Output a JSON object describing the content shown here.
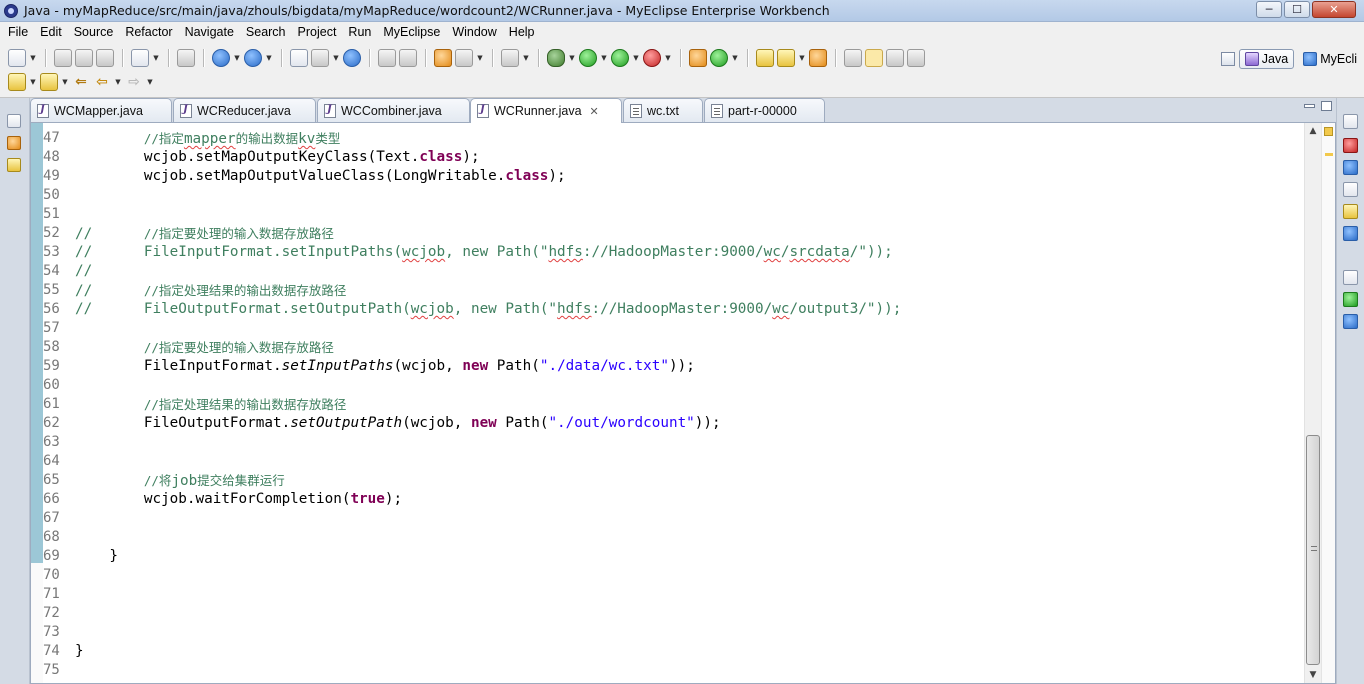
{
  "window": {
    "title": "Java - myMapReduce/src/main/java/zhouls/bigdata/myMapReduce/wordcount2/WCRunner.java - MyEclipse Enterprise Workbench",
    "buttons": {
      "minimize": "─",
      "maximize": "☐",
      "close": "✕"
    }
  },
  "menu": [
    "File",
    "Edit",
    "Source",
    "Refactor",
    "Navigate",
    "Search",
    "Project",
    "Run",
    "MyEclipse",
    "Window",
    "Help"
  ],
  "perspectives": [
    {
      "label": "Java",
      "active": true
    },
    {
      "label": "MyEcli",
      "active": false
    }
  ],
  "tabs": [
    {
      "label": "WCMapper.java",
      "kind": "java",
      "active": false
    },
    {
      "label": "WCReducer.java",
      "kind": "java",
      "active": false
    },
    {
      "label": "WCCombiner.java",
      "kind": "java",
      "active": false
    },
    {
      "label": "WCRunner.java",
      "kind": "java",
      "active": true,
      "close": "✕"
    },
    {
      "label": "wc.txt",
      "kind": "txt",
      "active": false
    },
    {
      "label": "part-r-00000",
      "kind": "txt",
      "active": false
    }
  ],
  "editor": {
    "line_numbers": [
      "47",
      "48",
      "49",
      "50",
      "51",
      "52",
      "53",
      "54",
      "55",
      "56",
      "57",
      "58",
      "59",
      "60",
      "61",
      "62",
      "63",
      "64",
      "65",
      "66",
      "67",
      "68",
      "69",
      "70",
      "71",
      "72",
      "73",
      "74",
      "75"
    ],
    "lines": [
      [
        {
          "t": "        "
        },
        {
          "t": "//指定",
          "c": "comment cjk"
        },
        {
          "t": "mapper",
          "c": "comment squiggle"
        },
        {
          "t": "的输出数据",
          "c": "comment cjk"
        },
        {
          "t": "kv",
          "c": "comment squiggle"
        },
        {
          "t": "类型",
          "c": "comment cjk"
        }
      ],
      [
        {
          "t": "        wcjob.setMapOutputKeyClass(Text."
        },
        {
          "t": "class",
          "c": "kw"
        },
        {
          "t": ");"
        }
      ],
      [
        {
          "t": "        wcjob.setMapOutputValueClass(LongWritable."
        },
        {
          "t": "class",
          "c": "kw"
        },
        {
          "t": ");"
        }
      ],
      [],
      [],
      [
        {
          "t": "//      ",
          "c": "comment"
        },
        {
          "t": "//指定要处理的输入数据存放路径",
          "c": "comment cjk"
        }
      ],
      [
        {
          "t": "//      FileInputFormat.setInputPaths(",
          "c": "comment"
        },
        {
          "t": "wcjob",
          "c": "comment squiggle"
        },
        {
          "t": ", new Path(\"",
          "c": "comment"
        },
        {
          "t": "hdfs",
          "c": "comment squiggle"
        },
        {
          "t": "://HadoopMaster:9000/",
          "c": "comment"
        },
        {
          "t": "wc",
          "c": "comment squiggle"
        },
        {
          "t": "/",
          "c": "comment"
        },
        {
          "t": "srcdata",
          "c": "comment squiggle"
        },
        {
          "t": "/\"));",
          "c": "comment"
        }
      ],
      [
        {
          "t": "//",
          "c": "comment"
        }
      ],
      [
        {
          "t": "//      ",
          "c": "comment"
        },
        {
          "t": "//指定处理结果的输出数据存放路径",
          "c": "comment cjk"
        }
      ],
      [
        {
          "t": "//      FileOutputFormat.setOutputPath(",
          "c": "comment"
        },
        {
          "t": "wcjob",
          "c": "comment squiggle"
        },
        {
          "t": ", new Path(\"",
          "c": "comment"
        },
        {
          "t": "hdfs",
          "c": "comment squiggle"
        },
        {
          "t": "://HadoopMaster:9000/",
          "c": "comment"
        },
        {
          "t": "wc",
          "c": "comment squiggle"
        },
        {
          "t": "/output3/\"));",
          "c": "comment"
        }
      ],
      [],
      [
        {
          "t": "        "
        },
        {
          "t": "//指定要处理的输入数据存放路径",
          "c": "comment cjk"
        }
      ],
      [
        {
          "t": "        FileInputFormat."
        },
        {
          "t": "setInputPaths",
          "c": "italic"
        },
        {
          "t": "(wcjob, "
        },
        {
          "t": "new",
          "c": "kw"
        },
        {
          "t": " Path("
        },
        {
          "t": "\"./data/wc.txt\"",
          "c": "str"
        },
        {
          "t": "));"
        }
      ],
      [],
      [
        {
          "t": "        "
        },
        {
          "t": "//指定处理结果的输出数据存放路径",
          "c": "comment cjk"
        }
      ],
      [
        {
          "t": "        FileOutputFormat."
        },
        {
          "t": "setOutputPath",
          "c": "italic"
        },
        {
          "t": "(wcjob, "
        },
        {
          "t": "new",
          "c": "kw"
        },
        {
          "t": " Path("
        },
        {
          "t": "\"./out/wordcount\"",
          "c": "str"
        },
        {
          "t": "));"
        }
      ],
      [],
      [],
      [
        {
          "t": "        "
        },
        {
          "t": "//将",
          "c": "comment cjk"
        },
        {
          "t": "job",
          "c": "comment"
        },
        {
          "t": "提交给集群运行",
          "c": "comment cjk"
        }
      ],
      [
        {
          "t": "        wcjob.waitForCompletion("
        },
        {
          "t": "true",
          "c": "kw"
        },
        {
          "t": ");"
        }
      ],
      [],
      [],
      [
        {
          "t": "    }"
        }
      ],
      [],
      [],
      [],
      [],
      [
        {
          "t": "}"
        }
      ],
      []
    ]
  }
}
